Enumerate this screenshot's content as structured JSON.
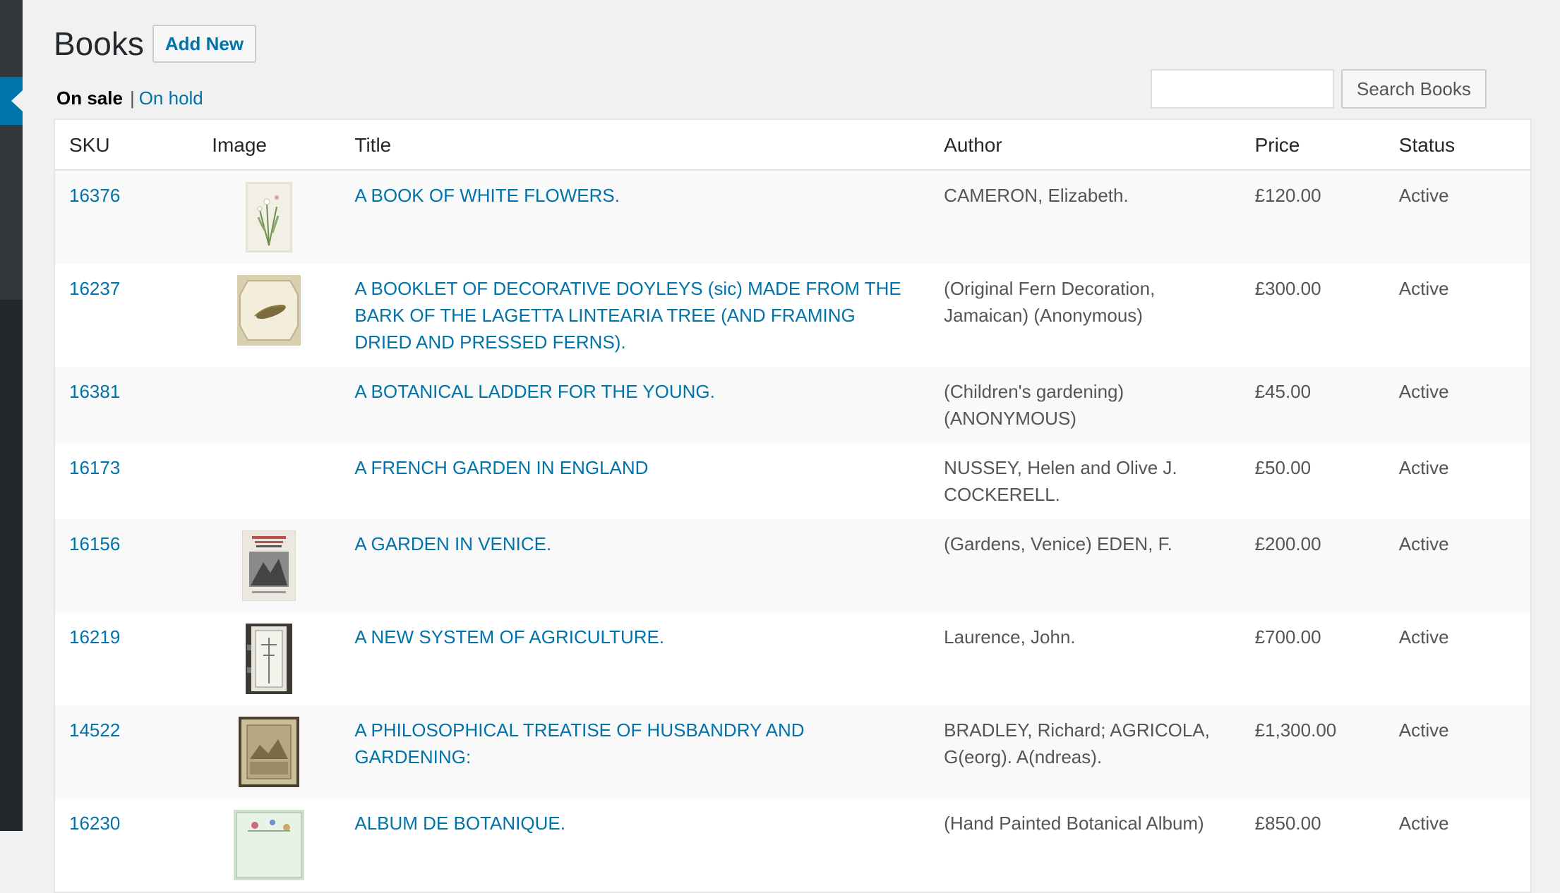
{
  "page": {
    "title": "Books",
    "add_new_label": "Add New"
  },
  "views": {
    "on_sale": "On sale",
    "separator": "|",
    "on_hold": "On hold"
  },
  "search": {
    "value": "",
    "placeholder": "",
    "button_label": "Search Books"
  },
  "columns": [
    "SKU",
    "Image",
    "Title",
    "Author",
    "Price",
    "Status"
  ],
  "rows": [
    {
      "sku": "16376",
      "title": "A BOOK OF WHITE FLOWERS.",
      "author": "CAMERON, Elizabeth.",
      "price": "£120.00",
      "status": "Active",
      "image": "white-flowers-thumbnail"
    },
    {
      "sku": "16237",
      "title": "A BOOKLET OF DECORATIVE DOYLEYS (sic) MADE FROM THE BARK OF THE LAGETTA LINTEARIA TREE (AND FRAMING DRIED AND PRESSED FERNS).",
      "author": "(Original Fern Decoration, Jamaican) (Anonymous)",
      "price": "£300.00",
      "status": "Active",
      "image": "doyley-thumbnail"
    },
    {
      "sku": "16381",
      "title": "A BOTANICAL LADDER FOR THE YOUNG.",
      "author": "(Children's gardening) (ANONYMOUS)",
      "price": "£45.00",
      "status": "Active",
      "image": ""
    },
    {
      "sku": "16173",
      "title": "A FRENCH GARDEN IN ENGLAND",
      "author": "NUSSEY, Helen and Olive J. COCKERELL.",
      "price": "£50.00",
      "status": "Active",
      "image": ""
    },
    {
      "sku": "16156",
      "title": "A GARDEN IN VENICE.",
      "author": "(Gardens, Venice) EDEN, F.",
      "price": "£200.00",
      "status": "Active",
      "image": "garden-venice-cover-thumbnail"
    },
    {
      "sku": "16219",
      "title": "A NEW SYSTEM OF AGRICULTURE.",
      "author": "Laurence, John.",
      "price": "£700.00",
      "status": "Active",
      "image": "agriculture-book-thumbnail"
    },
    {
      "sku": "14522",
      "title": "A PHILOSOPHICAL TREATISE OF HUSBANDRY AND GARDENING:",
      "author": "BRADLEY, Richard; AGRICOLA, G(eorg). A(ndreas).",
      "price": "£1,300.00",
      "status": "Active",
      "image": "treatise-engraving-thumbnail"
    },
    {
      "sku": "16230",
      "title": "ALBUM DE BOTANIQUE.",
      "author": "(Hand Painted Botanical Album)",
      "price": "£850.00",
      "status": "Active",
      "image": "botanical-album-thumbnail"
    }
  ],
  "colors": {
    "link": "#0073aa",
    "admin_bar": "#23282d",
    "active_menu": "#0073aa",
    "page_bg": "#f1f1f1"
  }
}
